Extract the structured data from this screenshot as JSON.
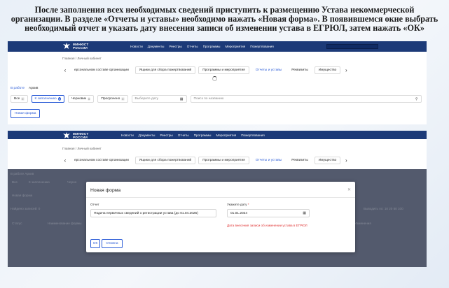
{
  "instruction": "После заполнения всех необходимых сведений приступить к размещению Устава некоммерческой организации. В разделе «Отчеты и уставы» необходимо нажать «Новая форма». В появившемся окне выбрать необходимый отчет и указать дату внесения записи об изменении устава в ЕГРЮЛ, затем нажать «ОК»",
  "header": {
    "logo_line1": "МИНЮСТ",
    "logo_line2": "РОССИИ",
    "nav": [
      "Новости",
      "Документы",
      "Реестры",
      "Отчеты",
      "Программы",
      "Мероприятия",
      "Пожертвования"
    ]
  },
  "breadcrumb": "Главная / Личный кабинет",
  "tabs": [
    "ерсональном составе организации",
    "Ящики для сбора пожертвований",
    "Программы и мероприятия",
    "Отчеты и уставы",
    "Реквизиты",
    "Имущество"
  ],
  "subtabs": [
    "В работе",
    "Архив"
  ],
  "filters": [
    {
      "label": "Все",
      "count": "0"
    },
    {
      "label": "К заполнению",
      "count": "0"
    },
    {
      "label": "Черновик",
      "count": "0"
    },
    {
      "label": "Просрочено",
      "count": "0"
    }
  ],
  "date_placeholder": "Выберите дату",
  "search_placeholder": "Поиск по названию",
  "new_form_label": "Новая форма",
  "ghost": {
    "subtabs": "В работе   Архив",
    "filter_all": "Все",
    "filter_fill": "К заполнению",
    "filter_draft": "Черно",
    "new_form": "Новая форма",
    "records": "Найдено записей: 0",
    "per_page": "Выводить по: 10   20   50   100",
    "col_status": "Статус",
    "col_name": "Наименование формы",
    "col_change": "Изменения"
  },
  "modal": {
    "title": "Новая форма",
    "report_label": "Отчет",
    "report_value": "Подача первичных сведений о регистрации устава (до 01.04.2025)",
    "date_label": "Укажите дату",
    "date_required_mark": "*",
    "date_value": "01.01.2024",
    "error": "Дата внесения записи об изменении устава в ЕГРЮЛ",
    "ok": "ОК",
    "cancel": "Отмена"
  },
  "colors": {
    "header_bg": "#1c3a78",
    "accent": "#2a5bd7",
    "error": "#e03535"
  }
}
